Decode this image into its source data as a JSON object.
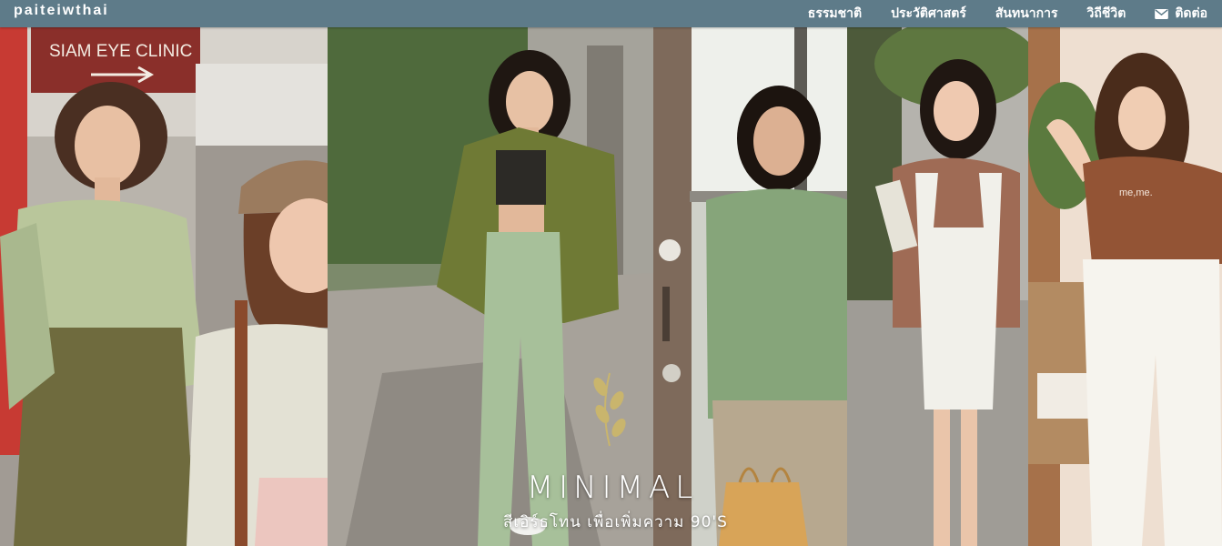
{
  "brand": "paiteiwthai",
  "nav": {
    "items": [
      {
        "label": "ธรรมชาติ"
      },
      {
        "label": "ประวัติศาสตร์"
      },
      {
        "label": "สันทนาการ"
      },
      {
        "label": "วิถีชีวิต"
      }
    ],
    "contact": {
      "label": "ติดต่อ",
      "icon": "envelope-icon"
    }
  },
  "hero": {
    "sign_text": "SIAM EYE CLINIC",
    "shirt_text": "me,me.",
    "title": "MINIMAL",
    "subtitle": "สีเอิร์ธโทน เพื่อเพิ่มความ 90'S"
  },
  "colors": {
    "navbar": "#5e7b89",
    "text": "#ffffff",
    "sage": "#a9b88e",
    "olive": "#6d6a3d",
    "green_shirt": "#86a57a"
  }
}
